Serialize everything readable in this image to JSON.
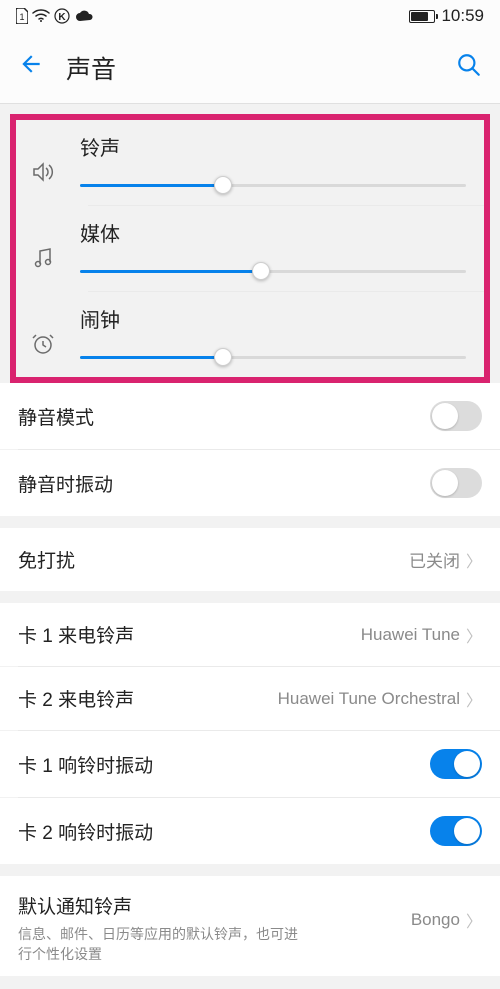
{
  "status": {
    "time": "10:59"
  },
  "header": {
    "title": "声音"
  },
  "sliders": {
    "ringtone": {
      "label": "铃声",
      "percent": 37
    },
    "media": {
      "label": "媒体",
      "percent": 47
    },
    "alarm": {
      "label": "闹钟",
      "percent": 37
    }
  },
  "silent_mode": {
    "label": "静音模式",
    "on": false
  },
  "vibrate_silent": {
    "label": "静音时振动",
    "on": false
  },
  "dnd": {
    "label": "免打扰",
    "value": "已关闭"
  },
  "sim1_ringtone": {
    "label": "卡 1 来电铃声",
    "value": "Huawei Tune"
  },
  "sim2_ringtone": {
    "label": "卡 2 来电铃声",
    "value": "Huawei Tune Orchestral"
  },
  "sim1_vibrate": {
    "label": "卡 1 响铃时振动",
    "on": true
  },
  "sim2_vibrate": {
    "label": "卡 2 响铃时振动",
    "on": true
  },
  "default_notification": {
    "label": "默认通知铃声",
    "desc": "信息、邮件、日历等应用的默认铃声，也可进行个性化设置",
    "value": "Bongo"
  }
}
